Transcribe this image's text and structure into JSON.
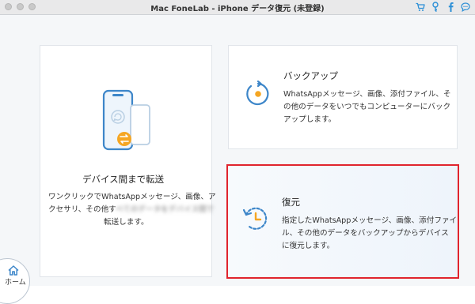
{
  "window": {
    "title": "Mac FoneLab - iPhone データ復元 (未登録)"
  },
  "toolbar_icons": [
    "cart-icon",
    "key-icon",
    "facebook-icon",
    "chat-icon"
  ],
  "cards": {
    "transfer": {
      "title": "デバイス間まで転送",
      "desc_line1": "ワンクリックでWhatsAppメッセージ、画像、ア",
      "desc_line2_a": "クセサリ、その他す",
      "desc_line2_blur": "べてのデータをデバイス間で",
      "desc_line3": "転送します。"
    },
    "backup": {
      "title": "バックアップ",
      "desc_line1": "WhatsAppメッセージ、画像、添付ファイル、そ",
      "desc_line2": "の他のデータをいつでもコンピューターにバック",
      "desc_line3": "アップします。"
    },
    "restore": {
      "title": "復元",
      "desc_line1": "指定したWhatsAppメッセージ、画像、添付ファイ",
      "desc_line2": "ル、その他のデータをバックアップからデバイス",
      "desc_line3": "に復元します。"
    }
  },
  "nav": {
    "home_label": "ホーム"
  },
  "colors": {
    "accent_orange": "#f5a623",
    "accent_blue": "#3d86c9",
    "highlight_red": "#e0242d"
  }
}
